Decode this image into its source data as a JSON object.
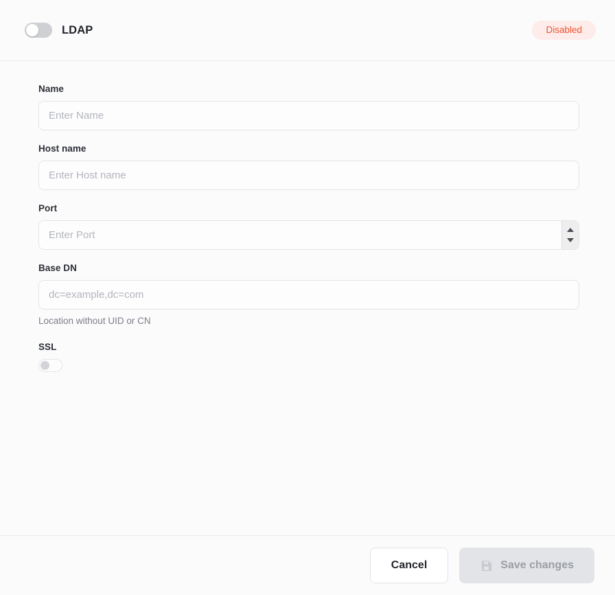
{
  "header": {
    "title": "LDAP",
    "enable_toggle": {
      "name": "ldap-enable-toggle",
      "state": "off",
      "aria_label": "Enable LDAP"
    },
    "status_badge": {
      "label": "Disabled",
      "bg_color": "#fdecea",
      "text_color": "#f0522f"
    }
  },
  "form": {
    "fields": [
      {
        "id": "name",
        "label": "Name",
        "placeholder": "Enter Name",
        "value": "",
        "type": "text"
      },
      {
        "id": "host_name",
        "label": "Host name",
        "placeholder": "Enter Host name",
        "value": "",
        "type": "text"
      },
      {
        "id": "port",
        "label": "Port",
        "placeholder": "Enter Port",
        "value": "",
        "type": "number"
      },
      {
        "id": "base_dn",
        "label": "Base DN",
        "placeholder": "dc=example,dc=com",
        "value": "",
        "type": "text",
        "helper": "Location without UID or CN"
      },
      {
        "id": "ssl",
        "label": "SSL",
        "type": "toggle",
        "state": "off"
      }
    ]
  },
  "footer": {
    "cancel_label": "Cancel",
    "save_label": "Save changes",
    "save_icon": "save-icon",
    "save_disabled": true
  },
  "colors": {
    "background": "#fbfbfc",
    "border": "#e4e4e9",
    "divider": "#e9e9ee",
    "label_text": "#2c2f36",
    "placeholder_text": "#b3b5bd",
    "helper_text": "#7b7e88",
    "disabled_button_bg": "#e3e4e8",
    "disabled_button_text": "#9b9ea6"
  }
}
